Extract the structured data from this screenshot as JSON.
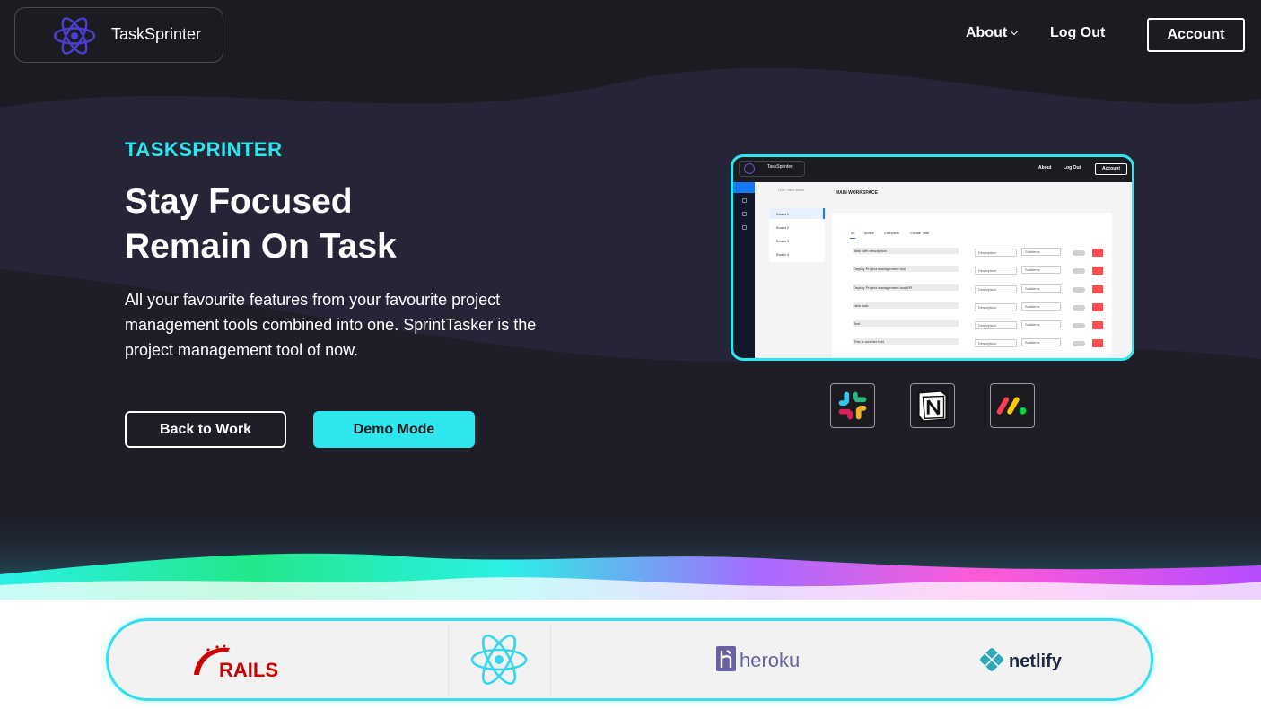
{
  "nav": {
    "brand_name": "TaskSprinter",
    "about_label": "About",
    "logout_label": "Log Out",
    "account_label": "Account"
  },
  "hero": {
    "eyebrow": "TASKSPRINTER",
    "headline_line1": "Stay Focused",
    "headline_line2": "Remain On Task",
    "subtext": "All your favourite features from your favourite project management tools combined into one. SprintTasker is the project management tool of now.",
    "back_button": "Back to Work",
    "demo_button": "Demo Mode"
  },
  "preview": {
    "brand_name": "TaskSprinter",
    "about": "About",
    "logout": "Log Out",
    "account": "Account",
    "breadcrumb": "Live  /  new name",
    "boards": [
      "Board 1",
      "Board 2",
      "Board 3",
      "Board 4"
    ],
    "workspace_title": "MAIN WORKSPACE",
    "tabs": [
      "All",
      "Active",
      "Complete",
      "Create Task"
    ],
    "tasks": [
      "Task with description",
      "Deploy Project management tool",
      "Deploy Project management tool API",
      "New task",
      "Test",
      "This is another test"
    ],
    "description_label": "Description",
    "subitems_label": "Subitems"
  },
  "integrations": [
    "slack-icon",
    "notion-icon",
    "monday-icon"
  ],
  "tech_stack": [
    "RAILS",
    "react-icon",
    "heroku",
    "netlify"
  ],
  "colors": {
    "accent": "#2ee6ee",
    "hero_bg": "#1c1b22",
    "react_purple": "#4b3fd1"
  }
}
